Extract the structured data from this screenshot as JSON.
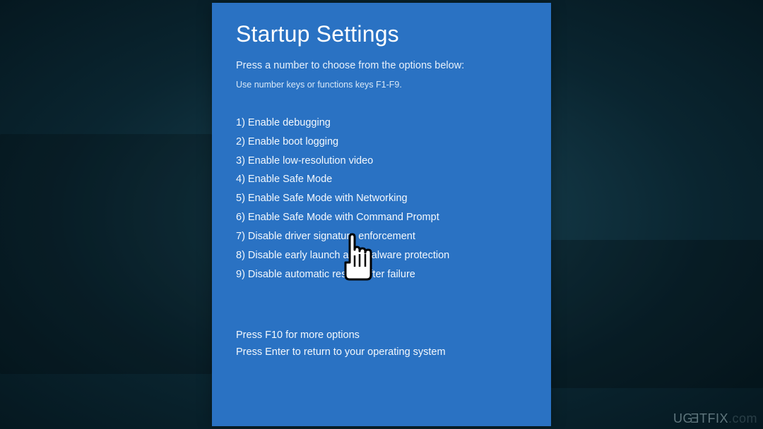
{
  "window": {
    "title": "Startup Settings",
    "subtitle": "Press a number to choose from the options below:",
    "hint": "Use number keys or functions keys F1-F9.",
    "options": [
      "1) Enable debugging",
      "2) Enable boot logging",
      "3) Enable low-resolution video",
      "4) Enable Safe Mode",
      "5) Enable Safe Mode with Networking",
      "6) Enable Safe Mode with Command Prompt",
      "7) Disable driver signature enforcement",
      "8) Disable early launch anti-malware protection",
      "9) Disable automatic restart after failure"
    ],
    "footer": [
      "Press F10 for more options",
      "Press Enter to return to your operating system"
    ]
  },
  "watermark": "UGETFIX"
}
